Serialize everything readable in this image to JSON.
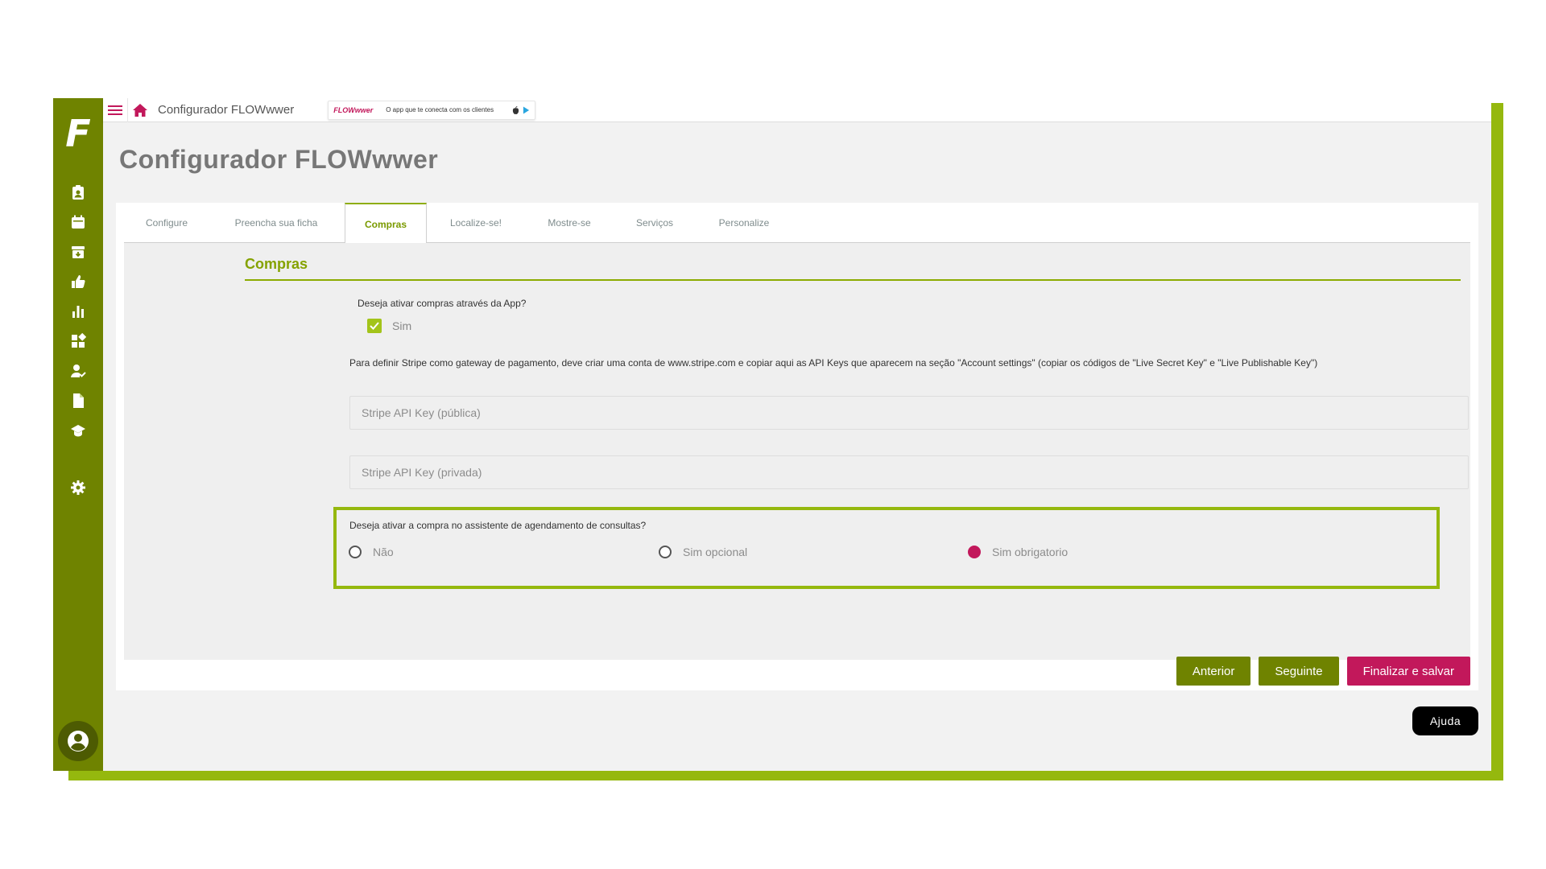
{
  "app": {
    "logo_letter": "F",
    "topbar_title": "Configurador FLOWwwer",
    "promo": {
      "brand": "FLOWwwer",
      "text": "O app que te conecta com os clientes"
    }
  },
  "sidebar": {
    "items": [
      {
        "icon": "clipboard-user-icon"
      },
      {
        "icon": "calendar-icon"
      },
      {
        "icon": "archive-icon"
      },
      {
        "icon": "thumbs-up-icon"
      },
      {
        "icon": "bar-chart-icon"
      },
      {
        "icon": "apps-grid-icon"
      },
      {
        "icon": "user-check-icon"
      },
      {
        "icon": "document-icon"
      },
      {
        "icon": "graduation-cap-icon"
      }
    ],
    "settings_icon": "gear-icon",
    "avatar_icon": "user-circle-icon"
  },
  "page": {
    "title": "Configurador FLOWwwer"
  },
  "tabs": [
    {
      "label": "Configure",
      "active": false
    },
    {
      "label": "Preencha sua ficha",
      "active": false
    },
    {
      "label": "Compras",
      "active": true
    },
    {
      "label": "Localize-se!",
      "active": false
    },
    {
      "label": "Mostre-se",
      "active": false
    },
    {
      "label": "Serviços",
      "active": false
    },
    {
      "label": "Personalize",
      "active": false
    }
  ],
  "compras": {
    "section_title": "Compras",
    "question_app": "Deseja ativar compras através da App?",
    "checkbox_label": "Sim",
    "checkbox_checked": true,
    "stripe_info": "Para definir Stripe como gateway de pagamento, deve criar uma conta de www.stripe.com e copiar aqui as API Keys que aparecem na seção \"Account settings\" (copiar os códigos de \"Live Secret Key\" e \"Live Publishable Key\")",
    "public_key_placeholder": "Stripe API Key (pública)",
    "public_key_value": "",
    "private_key_placeholder": "Stripe API Key (privada)",
    "private_key_value": "",
    "question_booking": "Deseja ativar a compra no assistente de agendamento de consultas?",
    "options": [
      {
        "label": "Não",
        "selected": false
      },
      {
        "label": "Sim opcional",
        "selected": false
      },
      {
        "label": "Sim obrigatorio",
        "selected": true
      }
    ]
  },
  "buttons": {
    "previous": "Anterior",
    "next": "Seguinte",
    "finish": "Finalizar e salvar"
  },
  "help_label": "Ajuda",
  "colors": {
    "sidebar": "#6f8300",
    "accent_lime": "#95b80e",
    "accent_magenta": "#c2185b"
  }
}
